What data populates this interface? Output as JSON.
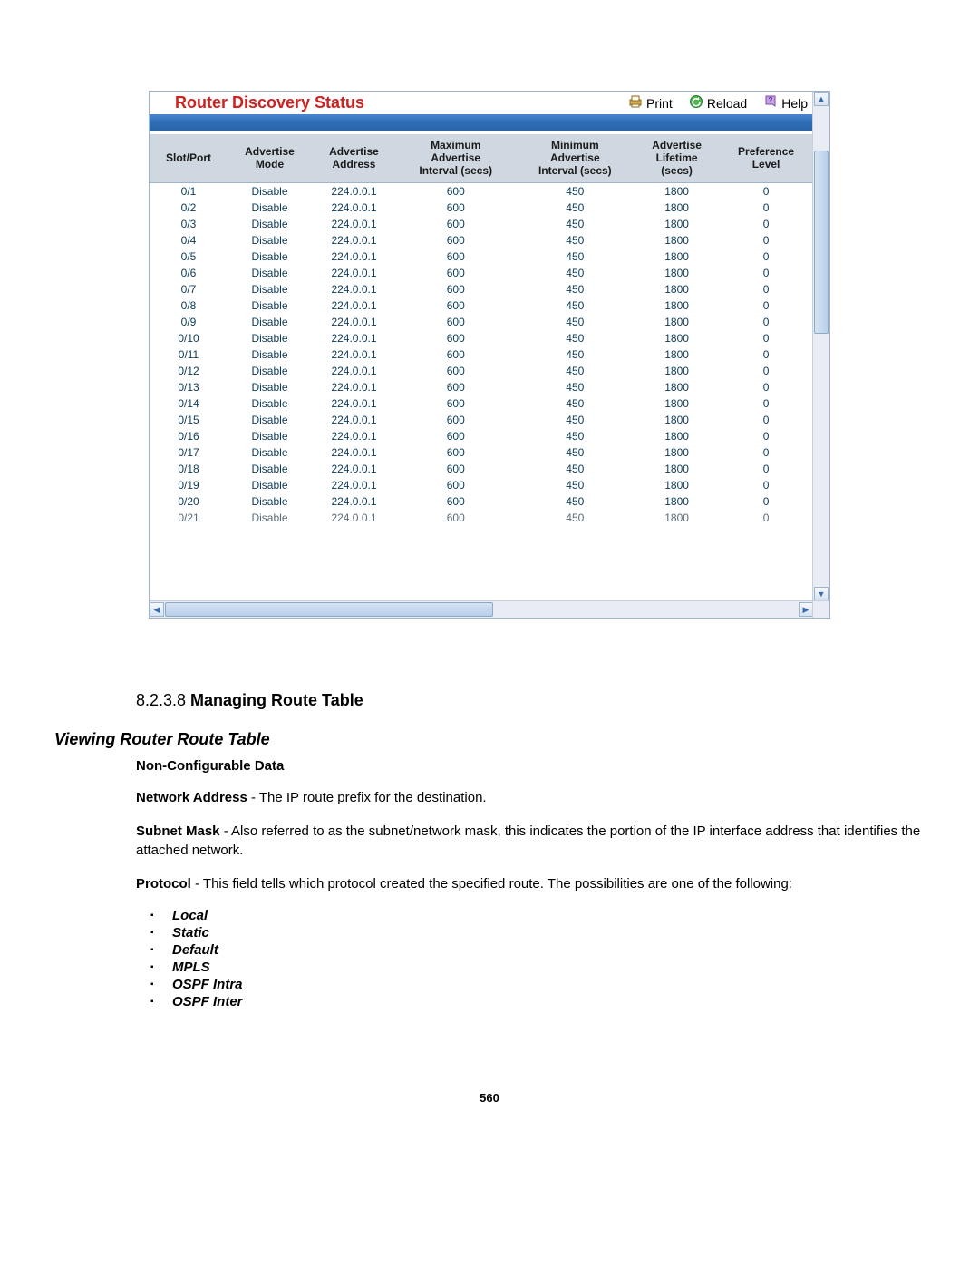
{
  "panel": {
    "title": "Router Discovery Status",
    "actions": {
      "print": "Print",
      "reload": "Reload",
      "help": "Help"
    }
  },
  "table": {
    "headers": {
      "slot_port": "Slot/Port",
      "adv_mode": "Advertise Mode",
      "adv_addr": "Advertise Address",
      "max_int": "Maximum Advertise Interval (secs)",
      "min_int": "Minimum Advertise Interval (secs)",
      "lifetime": "Advertise Lifetime (secs)",
      "pref": "Preference Level"
    },
    "rows": [
      {
        "slot": "0/1",
        "mode": "Disable",
        "addr": "224.0.0.1",
        "max": "600",
        "min": "450",
        "life": "1800",
        "pref": "0"
      },
      {
        "slot": "0/2",
        "mode": "Disable",
        "addr": "224.0.0.1",
        "max": "600",
        "min": "450",
        "life": "1800",
        "pref": "0"
      },
      {
        "slot": "0/3",
        "mode": "Disable",
        "addr": "224.0.0.1",
        "max": "600",
        "min": "450",
        "life": "1800",
        "pref": "0"
      },
      {
        "slot": "0/4",
        "mode": "Disable",
        "addr": "224.0.0.1",
        "max": "600",
        "min": "450",
        "life": "1800",
        "pref": "0"
      },
      {
        "slot": "0/5",
        "mode": "Disable",
        "addr": "224.0.0.1",
        "max": "600",
        "min": "450",
        "life": "1800",
        "pref": "0"
      },
      {
        "slot": "0/6",
        "mode": "Disable",
        "addr": "224.0.0.1",
        "max": "600",
        "min": "450",
        "life": "1800",
        "pref": "0"
      },
      {
        "slot": "0/7",
        "mode": "Disable",
        "addr": "224.0.0.1",
        "max": "600",
        "min": "450",
        "life": "1800",
        "pref": "0"
      },
      {
        "slot": "0/8",
        "mode": "Disable",
        "addr": "224.0.0.1",
        "max": "600",
        "min": "450",
        "life": "1800",
        "pref": "0"
      },
      {
        "slot": "0/9",
        "mode": "Disable",
        "addr": "224.0.0.1",
        "max": "600",
        "min": "450",
        "life": "1800",
        "pref": "0"
      },
      {
        "slot": "0/10",
        "mode": "Disable",
        "addr": "224.0.0.1",
        "max": "600",
        "min": "450",
        "life": "1800",
        "pref": "0"
      },
      {
        "slot": "0/11",
        "mode": "Disable",
        "addr": "224.0.0.1",
        "max": "600",
        "min": "450",
        "life": "1800",
        "pref": "0"
      },
      {
        "slot": "0/12",
        "mode": "Disable",
        "addr": "224.0.0.1",
        "max": "600",
        "min": "450",
        "life": "1800",
        "pref": "0"
      },
      {
        "slot": "0/13",
        "mode": "Disable",
        "addr": "224.0.0.1",
        "max": "600",
        "min": "450",
        "life": "1800",
        "pref": "0"
      },
      {
        "slot": "0/14",
        "mode": "Disable",
        "addr": "224.0.0.1",
        "max": "600",
        "min": "450",
        "life": "1800",
        "pref": "0"
      },
      {
        "slot": "0/15",
        "mode": "Disable",
        "addr": "224.0.0.1",
        "max": "600",
        "min": "450",
        "life": "1800",
        "pref": "0"
      },
      {
        "slot": "0/16",
        "mode": "Disable",
        "addr": "224.0.0.1",
        "max": "600",
        "min": "450",
        "life": "1800",
        "pref": "0"
      },
      {
        "slot": "0/17",
        "mode": "Disable",
        "addr": "224.0.0.1",
        "max": "600",
        "min": "450",
        "life": "1800",
        "pref": "0"
      },
      {
        "slot": "0/18",
        "mode": "Disable",
        "addr": "224.0.0.1",
        "max": "600",
        "min": "450",
        "life": "1800",
        "pref": "0"
      },
      {
        "slot": "0/19",
        "mode": "Disable",
        "addr": "224.0.0.1",
        "max": "600",
        "min": "450",
        "life": "1800",
        "pref": "0"
      },
      {
        "slot": "0/20",
        "mode": "Disable",
        "addr": "224.0.0.1",
        "max": "600",
        "min": "450",
        "life": "1800",
        "pref": "0"
      },
      {
        "slot": "0/21",
        "mode": "Disable",
        "addr": "224.0.0.1",
        "max": "600",
        "min": "450",
        "life": "1800",
        "pref": "0"
      }
    ]
  },
  "doc": {
    "section_number": "8.2.3.8 ",
    "section_title": "Managing Route Table",
    "subheading": "Viewing Router Route Table",
    "noncfg": "Non-Configurable Data",
    "defs": {
      "network_address_label": "Network Address",
      "network_address_text": " - The IP route prefix for the destination.",
      "subnet_mask_label": "Subnet Mask",
      "subnet_mask_text": " - Also referred to as the subnet/network mask, this indicates the portion of the IP interface address that identifies the attached network.",
      "protocol_label": "Protocol",
      "protocol_text": " - This field tells which protocol created the specified route. The possibilities are one of the following:"
    },
    "protocols": [
      "Local",
      "Static",
      "Default",
      "MPLS",
      "OSPF Intra",
      "OSPF Inter"
    ],
    "page_number": "560"
  }
}
